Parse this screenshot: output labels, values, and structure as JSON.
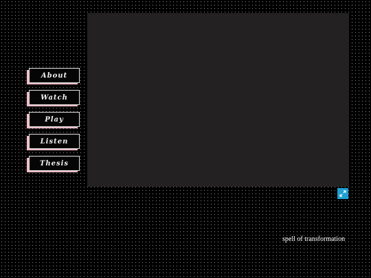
{
  "menu": {
    "items": [
      {
        "label": "About"
      },
      {
        "label": "Watch"
      },
      {
        "label": "Play"
      },
      {
        "label": "Listen"
      },
      {
        "label": "Thesis"
      }
    ]
  },
  "expand": {
    "icon": "expand-arrows-icon"
  },
  "caption": "spell of transformation",
  "colors": {
    "background": "#000000",
    "stage": "#232122",
    "button_shadow": "#f4b9c6",
    "expand_button": "#1f9fd1"
  }
}
